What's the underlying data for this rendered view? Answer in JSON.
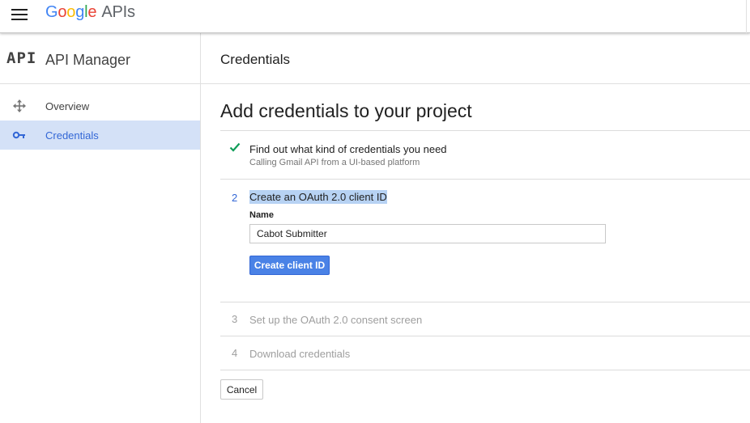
{
  "topbar": {
    "logo_letters": [
      "G",
      "o",
      "o",
      "g",
      "l",
      "e"
    ],
    "logo_suffix": "APIs",
    "menu_icon": "hamburger-menu-icon"
  },
  "sidebar": {
    "glyph": "API",
    "title": "API Manager",
    "items": [
      {
        "label": "Overview",
        "icon": "overview-arrows-icon",
        "active": false
      },
      {
        "label": "Credentials",
        "icon": "key-icon",
        "active": true
      }
    ]
  },
  "main": {
    "header_title": "Credentials",
    "page_title": "Add credentials to your project",
    "steps": [
      {
        "number": "",
        "status": "done",
        "title": "Find out what kind of credentials you need",
        "subtitle": "Calling Gmail API from a UI-based platform"
      },
      {
        "number": "2",
        "status": "active",
        "title": "Create an OAuth 2.0 client ID"
      },
      {
        "number": "3",
        "status": "pending",
        "title": "Set up the OAuth 2.0 consent screen"
      },
      {
        "number": "4",
        "status": "pending",
        "title": "Download credentials"
      }
    ],
    "form": {
      "name_label": "Name",
      "name_value": "Cabot Submitter",
      "create_button": "Create client ID"
    },
    "cancel_button": "Cancel"
  },
  "colors": {
    "accent": "#3367d6",
    "active_nav_bg": "#d4e1f7",
    "primary_button": "#4a82e6",
    "check_green": "#0f9d58",
    "highlight": "#b7d2f3"
  }
}
